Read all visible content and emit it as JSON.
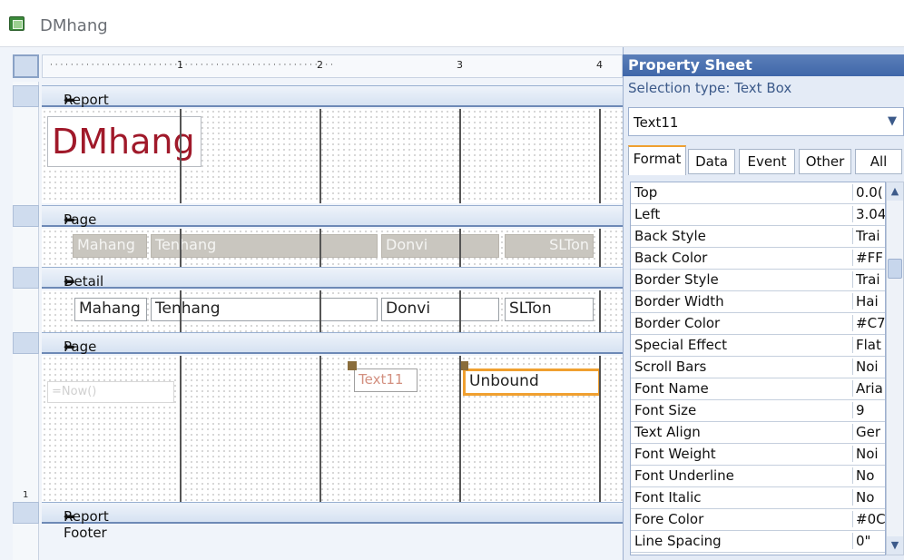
{
  "window": {
    "title": "DMhang"
  },
  "ruler": {
    "marks": [
      "1",
      "2",
      "3",
      "4"
    ]
  },
  "vruler": {
    "marks": [
      "1"
    ]
  },
  "sections": {
    "report_header": "Report Header",
    "page_header": "Page Header",
    "detail": "Detail",
    "page_footer": "Page Footer",
    "report_footer": "Report Footer"
  },
  "report_header": {
    "title": "DMhang"
  },
  "page_header": {
    "labels": [
      "Mahang",
      "Tenhang",
      "Donvi",
      "SLTon"
    ]
  },
  "detail": {
    "fields": [
      "Mahang",
      "Tenhang",
      "Donvi",
      "SLTon"
    ]
  },
  "page_footer": {
    "label": "Text11",
    "textbox": "Unbound",
    "faint": "=Now()"
  },
  "property_sheet": {
    "title": "Property Sheet",
    "selection_type": "Selection type:  Text Box",
    "selected_control": "Text11",
    "tabs": [
      "Format",
      "Data",
      "Event",
      "Other",
      "All"
    ],
    "properties": [
      {
        "name": "Top",
        "value": "0.0("
      },
      {
        "name": "Left",
        "value": "3.04"
      },
      {
        "name": "Back Style",
        "value": "Trai"
      },
      {
        "name": "Back Color",
        "value": "#FF"
      },
      {
        "name": "Border Style",
        "value": "Trai"
      },
      {
        "name": "Border Width",
        "value": "Hai"
      },
      {
        "name": "Border Color",
        "value": "#C7"
      },
      {
        "name": "Special Effect",
        "value": "Flat"
      },
      {
        "name": "Scroll Bars",
        "value": "Noi"
      },
      {
        "name": "Font Name",
        "value": "Aria"
      },
      {
        "name": "Font Size",
        "value": "9"
      },
      {
        "name": "Text Align",
        "value": "Ger"
      },
      {
        "name": "Font Weight",
        "value": "Noi"
      },
      {
        "name": "Font Underline",
        "value": "No"
      },
      {
        "name": "Font Italic",
        "value": "No"
      },
      {
        "name": "Fore Color",
        "value": "#0C"
      },
      {
        "name": "Line Spacing",
        "value": "0\""
      }
    ]
  },
  "colors": {
    "accent": "#3f67a9",
    "selection": "#f0a030",
    "title_red": "#a0192a"
  },
  "icons": [
    "report-icon",
    "section-arrow-icon",
    "dropdown-icon",
    "scroll-up-icon",
    "scroll-down-icon",
    "close-icon"
  ]
}
